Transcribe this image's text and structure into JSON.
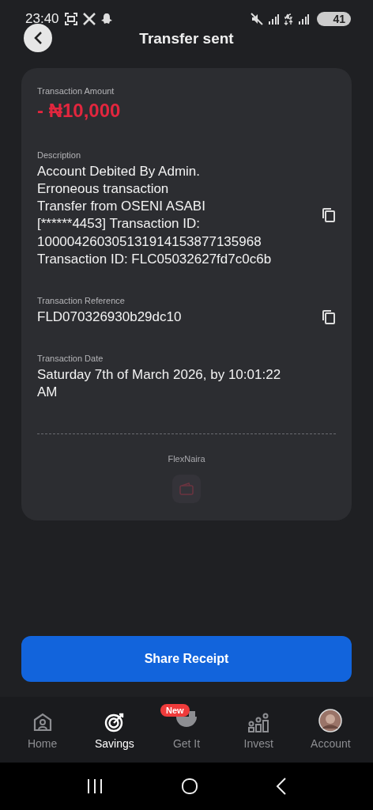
{
  "status_bar": {
    "time": "23:40",
    "battery": "41"
  },
  "header": {
    "title": "Transfer sent"
  },
  "receipt": {
    "fields": [
      {
        "kind": "amount",
        "label": "Transaction Amount",
        "lines": [
          "- ₦10,000"
        ],
        "copyable": false
      },
      {
        "kind": "text",
        "label": "Description",
        "lines": [
          "Account Debited By Admin.",
          "Erroneous transaction",
          "Transfer from OSENI ASABI",
          "[******4453] Transaction ID:",
          "1000042603051319141538771​35968",
          "Transaction ID: FLC05032627fd7c0c6b"
        ],
        "copyable": true
      },
      {
        "kind": "text",
        "label": "Transaction Reference",
        "lines": [
          "FLD070326930b29dc10"
        ],
        "copyable": true
      },
      {
        "kind": "text",
        "label": "Transaction Date",
        "lines": [
          "Saturday 7th of March 2026, by 10:01:22",
          "AM"
        ],
        "copyable": false
      }
    ],
    "brand": "FlexNaira"
  },
  "share_button": "Share Receipt",
  "bottom_nav": [
    {
      "kind": "home",
      "label": "Home",
      "selected": false
    },
    {
      "kind": "savings",
      "label": "Savings",
      "selected": true
    },
    {
      "kind": "getit",
      "label": "Get It",
      "selected": false,
      "badge": "New"
    },
    {
      "kind": "invest",
      "label": "Invest",
      "selected": false
    },
    {
      "kind": "account",
      "label": "Account",
      "selected": false
    }
  ]
}
